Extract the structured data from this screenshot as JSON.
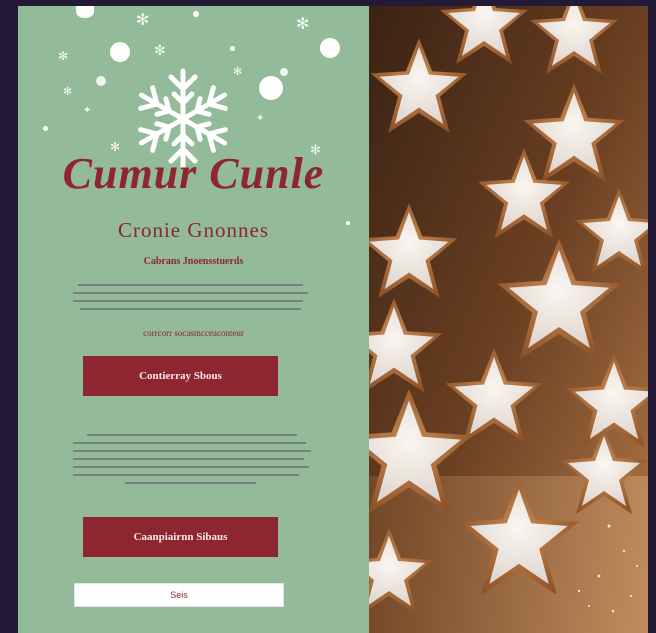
{
  "hero": {
    "title": "Cumur Cunle",
    "subtitle": "Cronie Gnonnes",
    "tagline": "Cabrans Jnoensstuerds",
    "sub_note": "corrcorr socasmcceaconteur"
  },
  "actions": {
    "primary_label": "Contierray Sbous",
    "secondary_label": "Caanpiairnn Sibaus"
  },
  "signup": {
    "input_value": "Seis"
  },
  "colors": {
    "panel": "#93ba99",
    "accent": "#8e2630",
    "background": "#231a35"
  },
  "icons": {
    "hero_icon": "snowflake-icon"
  }
}
